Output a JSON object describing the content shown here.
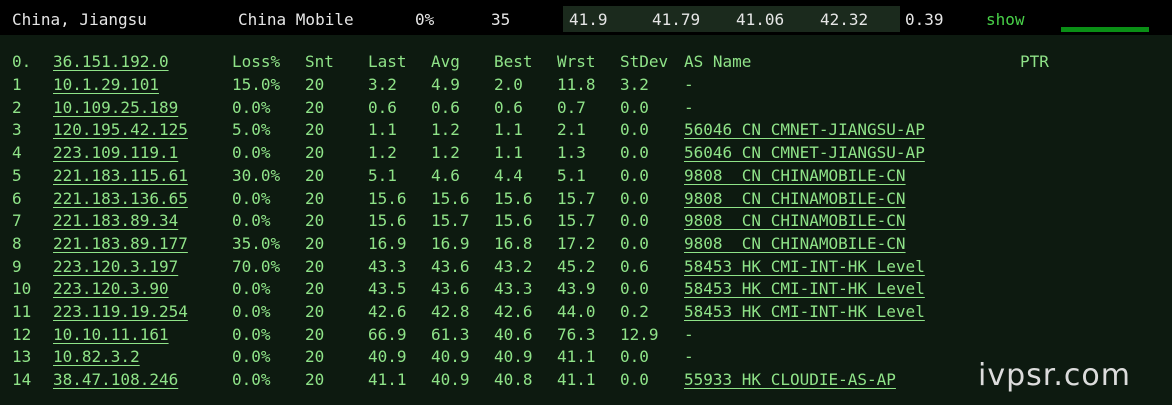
{
  "summary": {
    "location": "China, Jiangsu",
    "isp": "China Mobile",
    "loss": "0%",
    "sent": "35",
    "last": "41.9",
    "avg": "41.79",
    "best": "41.06",
    "worst": "42.32",
    "stdev": "0.39",
    "show_label": "show"
  },
  "headers": {
    "idx": "0.",
    "host": "36.151.192.0",
    "loss": "Loss%",
    "snt": "Snt",
    "last": "Last",
    "avg": "Avg",
    "best": "Best",
    "wrst": "Wrst",
    "stdev": "StDev",
    "as": "AS Name",
    "ptr": "PTR"
  },
  "hops": [
    {
      "idx": "1",
      "host": "10.1.29.101",
      "loss": "15.0%",
      "snt": "20",
      "last": "3.2",
      "avg": "4.9",
      "best": "2.0",
      "wrst": "11.8",
      "stdev": "3.2",
      "as": "-",
      "as_link": false
    },
    {
      "idx": "2",
      "host": "10.109.25.189",
      "loss": "0.0%",
      "snt": "20",
      "last": "0.6",
      "avg": "0.6",
      "best": "0.6",
      "wrst": "0.7",
      "stdev": "0.0",
      "as": "-",
      "as_link": false
    },
    {
      "idx": "3",
      "host": "120.195.42.125",
      "loss": "5.0%",
      "snt": "20",
      "last": "1.1",
      "avg": "1.2",
      "best": "1.1",
      "wrst": "2.1",
      "stdev": "0.0",
      "as": "56046 CN CMNET-JIANGSU-AP",
      "as_link": true
    },
    {
      "idx": "4",
      "host": "223.109.119.1",
      "loss": "0.0%",
      "snt": "20",
      "last": "1.2",
      "avg": "1.2",
      "best": "1.1",
      "wrst": "1.3",
      "stdev": "0.0",
      "as": "56046 CN CMNET-JIANGSU-AP",
      "as_link": true
    },
    {
      "idx": "5",
      "host": "221.183.115.61",
      "loss": "30.0%",
      "snt": "20",
      "last": "5.1",
      "avg": "4.6",
      "best": "4.4",
      "wrst": "5.1",
      "stdev": "0.0",
      "as": "9808  CN CHINAMOBILE-CN",
      "as_link": true
    },
    {
      "idx": "6",
      "host": "221.183.136.65",
      "loss": "0.0%",
      "snt": "20",
      "last": "15.6",
      "avg": "15.6",
      "best": "15.6",
      "wrst": "15.7",
      "stdev": "0.0",
      "as": "9808  CN CHINAMOBILE-CN",
      "as_link": true
    },
    {
      "idx": "7",
      "host": "221.183.89.34",
      "loss": "0.0%",
      "snt": "20",
      "last": "15.6",
      "avg": "15.7",
      "best": "15.6",
      "wrst": "15.7",
      "stdev": "0.0",
      "as": "9808  CN CHINAMOBILE-CN",
      "as_link": true
    },
    {
      "idx": "8",
      "host": "221.183.89.177",
      "loss": "35.0%",
      "snt": "20",
      "last": "16.9",
      "avg": "16.9",
      "best": "16.8",
      "wrst": "17.2",
      "stdev": "0.0",
      "as": "9808  CN CHINAMOBILE-CN",
      "as_link": true
    },
    {
      "idx": "9",
      "host": "223.120.3.197",
      "loss": "70.0%",
      "snt": "20",
      "last": "43.3",
      "avg": "43.6",
      "best": "43.2",
      "wrst": "45.2",
      "stdev": "0.6",
      "as": "58453 HK CMI-INT-HK Level",
      "as_link": true
    },
    {
      "idx": "10",
      "host": "223.120.3.90",
      "loss": "0.0%",
      "snt": "20",
      "last": "43.5",
      "avg": "43.6",
      "best": "43.3",
      "wrst": "43.9",
      "stdev": "0.0",
      "as": "58453 HK CMI-INT-HK Level",
      "as_link": true
    },
    {
      "idx": "11",
      "host": "223.119.19.254",
      "loss": "0.0%",
      "snt": "20",
      "last": "42.6",
      "avg": "42.8",
      "best": "42.6",
      "wrst": "44.0",
      "stdev": "0.2",
      "as": "58453 HK CMI-INT-HK Level",
      "as_link": true
    },
    {
      "idx": "12",
      "host": "10.10.11.161",
      "loss": "0.0%",
      "snt": "20",
      "last": "66.9",
      "avg": "61.3",
      "best": "40.6",
      "wrst": "76.3",
      "stdev": "12.9",
      "as": "-",
      "as_link": false
    },
    {
      "idx": "13",
      "host": "10.82.3.2",
      "loss": "0.0%",
      "snt": "20",
      "last": "40.9",
      "avg": "40.9",
      "best": "40.9",
      "wrst": "41.1",
      "stdev": "0.0",
      "as": "-",
      "as_link": false
    },
    {
      "idx": "14",
      "host": "38.47.108.246",
      "loss": "0.0%",
      "snt": "20",
      "last": "41.1",
      "avg": "40.9",
      "best": "40.8",
      "wrst": "41.1",
      "stdev": "0.0",
      "as": "55933 HK CLOUDIE-AS-AP",
      "as_link": true
    }
  ],
  "watermark": "ivpsr.com"
}
